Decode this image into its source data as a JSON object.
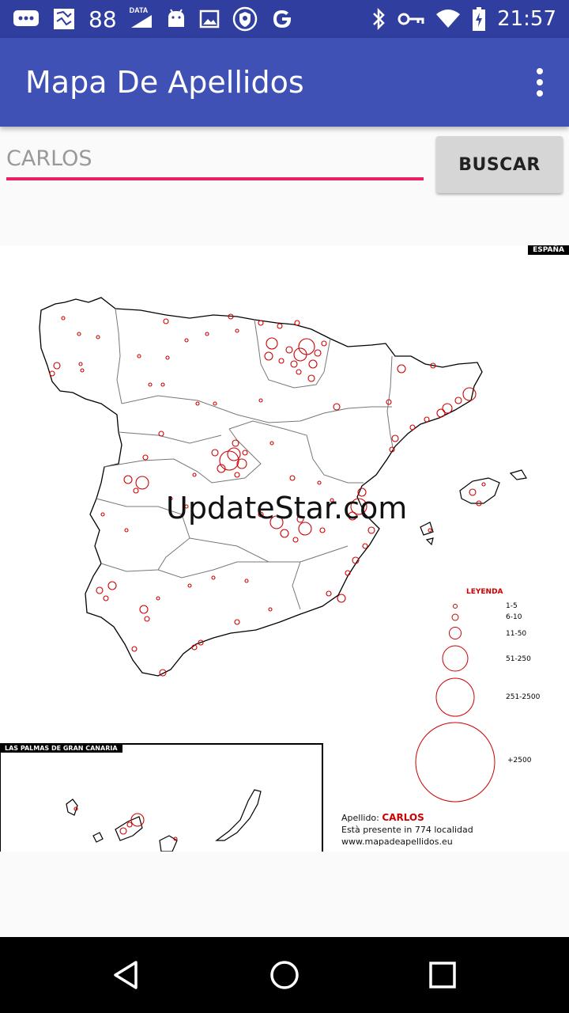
{
  "status_bar": {
    "notification_count": "88",
    "data_label": "DATA",
    "time": "21:57"
  },
  "app": {
    "title": "Mapa De Apellidos"
  },
  "search": {
    "placeholder": "CARLOS",
    "value": "",
    "button_label": "BUSCAR"
  },
  "map": {
    "country_badge": "ESPAÑA",
    "watermark": "UpdateStar.com",
    "canarias_label": "LAS PALMAS DE GRAN CANARIA",
    "legend": {
      "title": "LEYENDA",
      "ranges": [
        "1-5",
        "6-10",
        "11-50",
        "51-250",
        "251-2500",
        "+2500"
      ]
    },
    "info": {
      "surname_prefix": "Apellido:",
      "surname": "CARLOS",
      "presence": "Està presente in 774 localidad",
      "site": "www.mapadeapellidos.eu"
    },
    "marker_color": "#cc0000"
  },
  "colors": {
    "status_bar": "#303f9f",
    "app_bar": "#3f51b5",
    "accent": "#e91e63"
  }
}
